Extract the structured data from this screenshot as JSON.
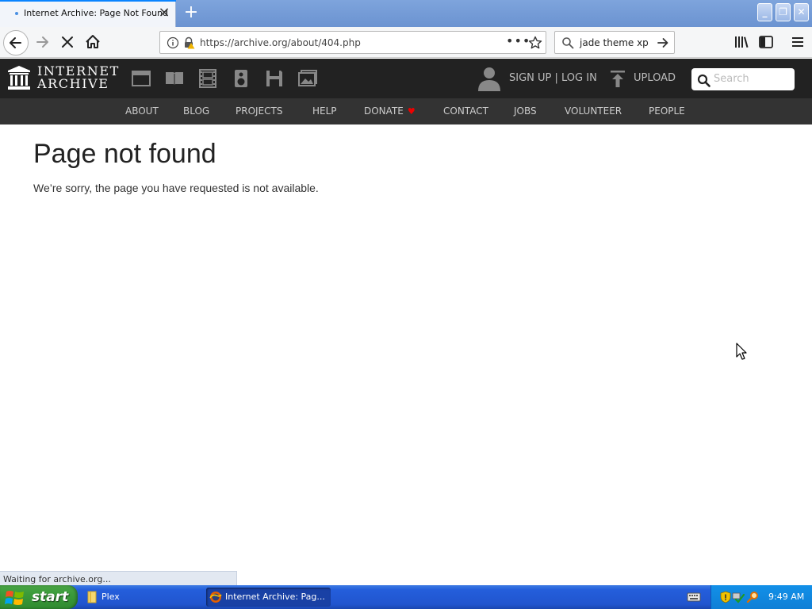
{
  "browser": {
    "tab": {
      "title": "Internet Archive: Page Not Found",
      "close_glyph": "×"
    },
    "new_tab_glyph": "+",
    "window_controls": {
      "minimize": "_",
      "maximize": "❐",
      "close": "✕"
    },
    "url": "https://archive.org/about/404.php",
    "more_glyph": "•••",
    "search_value": "jade theme xp",
    "status": "Waiting for archive.org..."
  },
  "site": {
    "logo_line1": "INTERNET",
    "logo_line2": "ARCHIVE",
    "media_icons": [
      "web-icon",
      "texts-icon",
      "video-icon",
      "audio-icon",
      "software-icon",
      "images-icon"
    ],
    "signup_login": "SIGN UP | LOG IN",
    "upload": "UPLOAD",
    "search_placeholder": "Search",
    "nav": [
      "ABOUT",
      "BLOG",
      "PROJECTS",
      "HELP",
      "DONATE",
      "CONTACT",
      "JOBS",
      "VOLUNTEER",
      "PEOPLE"
    ],
    "donate_glyph": "♥",
    "heart_color": "#e00000"
  },
  "page": {
    "heading": "Page not found",
    "message": "We’re sorry, the page you have requested is not available."
  },
  "taskbar": {
    "start": "start",
    "tasks": [
      "Plex",
      "Internet Archive: Pag..."
    ],
    "clock": "9:49 AM"
  },
  "colors": {
    "ia_header": "#222222",
    "ia_subnav": "#333333",
    "taskbar_blue": "#245edb",
    "start_green": "#3a9a3a",
    "tab_accent": "#0a84ff"
  }
}
